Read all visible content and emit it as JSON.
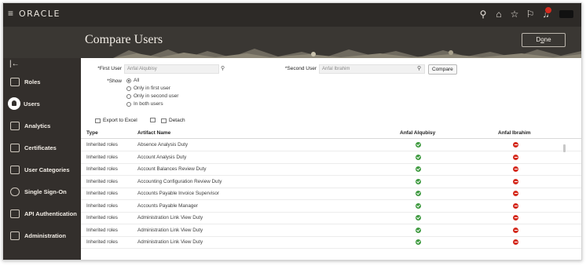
{
  "topbar": {
    "logo": "ORACLE",
    "icons": [
      "menu-icon",
      "search-icon",
      "home-icon",
      "star-icon",
      "flag-icon",
      "bell-icon"
    ]
  },
  "header": {
    "title": "Compare Users",
    "done_label": "Done",
    "done_accesskey": "o"
  },
  "sidebar": {
    "collapse_icon": "collapse-icon",
    "items": [
      {
        "label": "Roles",
        "icon": "roles-icon"
      },
      {
        "label": "Users",
        "icon": "user-icon",
        "active": true
      },
      {
        "label": "Analytics",
        "icon": "analytics-icon"
      },
      {
        "label": "Certificates",
        "icon": "certificate-icon"
      },
      {
        "label": "User Categories",
        "icon": "user-categories-icon"
      },
      {
        "label": "Single Sign-On",
        "icon": "cloud-icon"
      },
      {
        "label": "API Authentication",
        "icon": "api-key-icon"
      },
      {
        "label": "Administration",
        "icon": "administration-icon"
      }
    ]
  },
  "form": {
    "first_user_label": "First User",
    "first_user_value": "Anfal Alqubisy",
    "second_user_label": "Second User",
    "second_user_value": "Anfal Ibrahim",
    "compare_label": "Compare",
    "show_label": "Show",
    "show_options": [
      "All",
      "Only in first user",
      "Only in second user",
      "In both users"
    ],
    "show_selected": "All"
  },
  "toolbar": {
    "export_label": "Export to Excel",
    "detach_label": "Detach"
  },
  "table": {
    "columns": [
      "Type",
      "Artifact Name",
      "Anfal Alqubisy",
      "Anfal Ibrahim"
    ],
    "rows": [
      {
        "type": "Inherited roles",
        "name": "Absence Analysis Duty",
        "first": "yes",
        "second": "no"
      },
      {
        "type": "Inherited roles",
        "name": "Account Analysis Duty",
        "first": "yes",
        "second": "no"
      },
      {
        "type": "Inherited roles",
        "name": "Account Balances Review Duty",
        "first": "yes",
        "second": "no"
      },
      {
        "type": "Inherited roles",
        "name": "Accounting Configuration Review Duty",
        "first": "yes",
        "second": "no"
      },
      {
        "type": "Inherited roles",
        "name": "Accounts Payable Invoice Supervisor",
        "first": "yes",
        "second": "no"
      },
      {
        "type": "Inherited roles",
        "name": "Accounts Payable Manager",
        "first": "yes",
        "second": "no"
      },
      {
        "type": "Inherited roles",
        "name": "Administration Link View Duty",
        "first": "yes",
        "second": "no"
      },
      {
        "type": "Inherited roles",
        "name": "Administration Link View Duty",
        "first": "yes",
        "second": "no"
      },
      {
        "type": "Inherited roles",
        "name": "Administration Link View Duty",
        "first": "yes",
        "second": "no"
      }
    ]
  },
  "colors": {
    "topbar": "#2d2a27",
    "header": "#3a3733",
    "sidebar": "#332f2c",
    "yes": "#3f9a40",
    "no": "#d52b1e"
  }
}
